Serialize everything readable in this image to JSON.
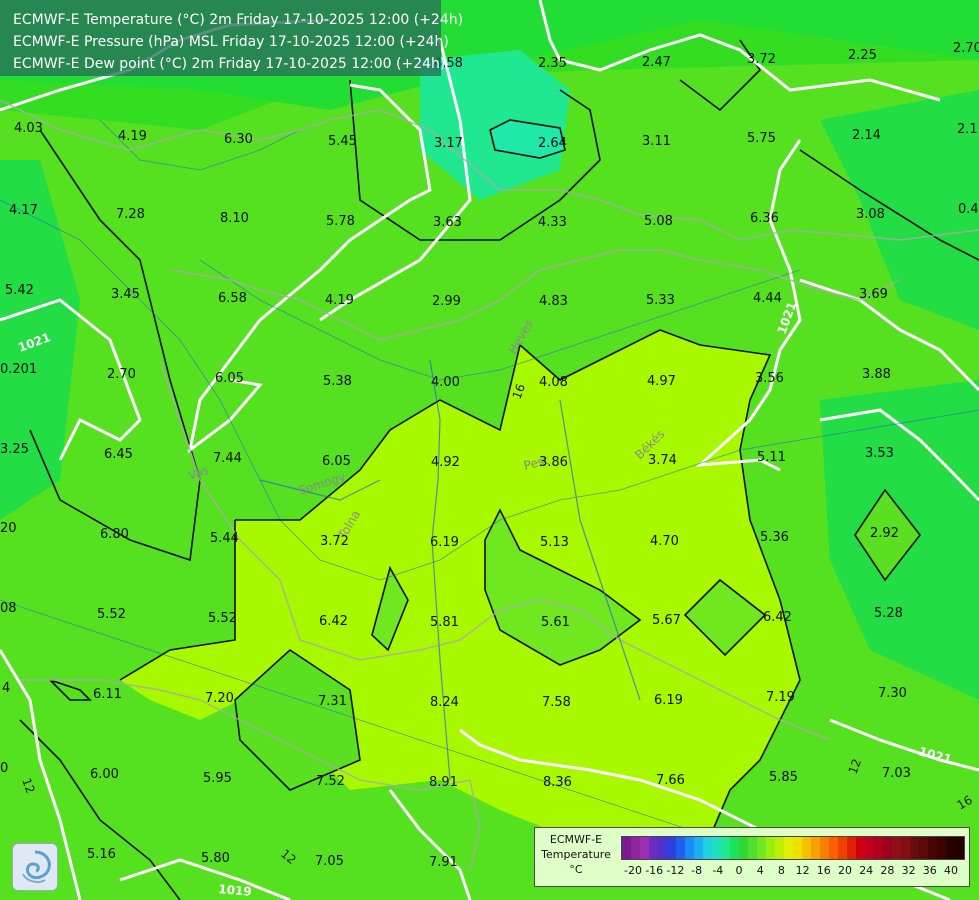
{
  "header": {
    "line1": "ECMWF-E Temperature (°C) 2m Friday 17-10-2025 12:00 (+24h)",
    "line2": "ECMWF-E Pressure (hPa) MSL Friday 17-10-2025 12:00 (+24h)",
    "line3": "ECMWF-E Dew point (°C) 2m Friday 17-10-2025 12:00 (+24h)"
  },
  "legend": {
    "title_line1": "ECMWF-E",
    "title_line2": "Temperature",
    "title_line3": "°C",
    "ticks": [
      "-20",
      "-16",
      "-12",
      "-8",
      "-4",
      "0",
      "4",
      "8",
      "12",
      "16",
      "20",
      "24",
      "28",
      "32",
      "36",
      "40"
    ],
    "colors": [
      "#7a1a8c",
      "#8e24a0",
      "#a02db2",
      "#6a2cc2",
      "#5030d0",
      "#3040e0",
      "#2060f0",
      "#1a8cf5",
      "#1ab0f0",
      "#20d0e0",
      "#20e0c0",
      "#20e890",
      "#20e060",
      "#30d830",
      "#50e030",
      "#70e820",
      "#98f010",
      "#c0f000",
      "#e0f000",
      "#f0e000",
      "#f8c000",
      "#f8a000",
      "#f88000",
      "#f86000",
      "#f04000",
      "#e02000",
      "#d00010",
      "#c00020",
      "#b00020",
      "#a00020",
      "#901018",
      "#801010",
      "#6a0c0c",
      "#5a0808",
      "#4a0404",
      "#3a0202",
      "#2a0000",
      "#200000"
    ]
  },
  "isolines": [
    "1021",
    "1021",
    "1021",
    "1019",
    "16",
    "12",
    "12",
    "12",
    "16"
  ],
  "regions": [
    "Vas",
    "Somogy",
    "Tolna",
    "Heves",
    "Pest",
    "Békés"
  ],
  "values": [
    {
      "t": "4.03"
    },
    {
      "t": "4.19"
    },
    {
      "t": "6.30"
    },
    {
      "t": "5.45"
    },
    {
      "t": "3.17"
    },
    {
      "t": "2.64"
    },
    {
      "t": "3.11"
    },
    {
      "t": "5.75"
    },
    {
      "t": "2.14"
    },
    {
      "t": "2.1"
    },
    {
      "t": "4.58"
    },
    {
      "t": "2.35"
    },
    {
      "t": "2.47"
    },
    {
      "t": "3.72"
    },
    {
      "t": "2.25"
    },
    {
      "t": "2.70"
    },
    {
      "t": "4.17"
    },
    {
      "t": "7.28"
    },
    {
      "t": "8.10"
    },
    {
      "t": "5.78"
    },
    {
      "t": "3.63"
    },
    {
      "t": "4.33"
    },
    {
      "t": "5.08"
    },
    {
      "t": "6.36"
    },
    {
      "t": "3.08"
    },
    {
      "t": "0.4"
    },
    {
      "t": "5.42"
    },
    {
      "t": "3.45"
    },
    {
      "t": "6.58"
    },
    {
      "t": "4.19"
    },
    {
      "t": "2.99"
    },
    {
      "t": "4.83"
    },
    {
      "t": "5.33"
    },
    {
      "t": "4.44"
    },
    {
      "t": "3.69"
    },
    {
      "t": "0.201"
    },
    {
      "t": "2.70"
    },
    {
      "t": "6.05"
    },
    {
      "t": "5.38"
    },
    {
      "t": "4.00"
    },
    {
      "t": "4.08"
    },
    {
      "t": "4.97"
    },
    {
      "t": "3.56"
    },
    {
      "t": "3.88"
    },
    {
      "t": "3.25"
    },
    {
      "t": "6.45"
    },
    {
      "t": "7.44"
    },
    {
      "t": "6.05"
    },
    {
      "t": "4.92"
    },
    {
      "t": "3.86"
    },
    {
      "t": "3.74"
    },
    {
      "t": "5.11"
    },
    {
      "t": "3.53"
    },
    {
      "t": "20"
    },
    {
      "t": "6.80"
    },
    {
      "t": "5.44"
    },
    {
      "t": "3.72"
    },
    {
      "t": "6.19"
    },
    {
      "t": "5.13"
    },
    {
      "t": "4.70"
    },
    {
      "t": "5.36"
    },
    {
      "t": "2.92"
    },
    {
      "t": "08"
    },
    {
      "t": "5.52"
    },
    {
      "t": "5.52"
    },
    {
      "t": "6.42"
    },
    {
      "t": "5.81"
    },
    {
      "t": "5.61"
    },
    {
      "t": "5.67"
    },
    {
      "t": "6.42"
    },
    {
      "t": "5.28"
    },
    {
      "t": "4"
    },
    {
      "t": "6.11"
    },
    {
      "t": "7.20"
    },
    {
      "t": "7.31"
    },
    {
      "t": "8.24"
    },
    {
      "t": "7.58"
    },
    {
      "t": "6.19"
    },
    {
      "t": "7.19"
    },
    {
      "t": "7.30"
    },
    {
      "t": "0"
    },
    {
      "t": "6.00"
    },
    {
      "t": "5.95"
    },
    {
      "t": "7.52"
    },
    {
      "t": "8.91"
    },
    {
      "t": "8.36"
    },
    {
      "t": "7.66"
    },
    {
      "t": "5.85"
    },
    {
      "t": "7.03"
    },
    {
      "t": "5.16"
    },
    {
      "t": "5.80"
    },
    {
      "t": "7.05"
    },
    {
      "t": "7.91"
    }
  ]
}
